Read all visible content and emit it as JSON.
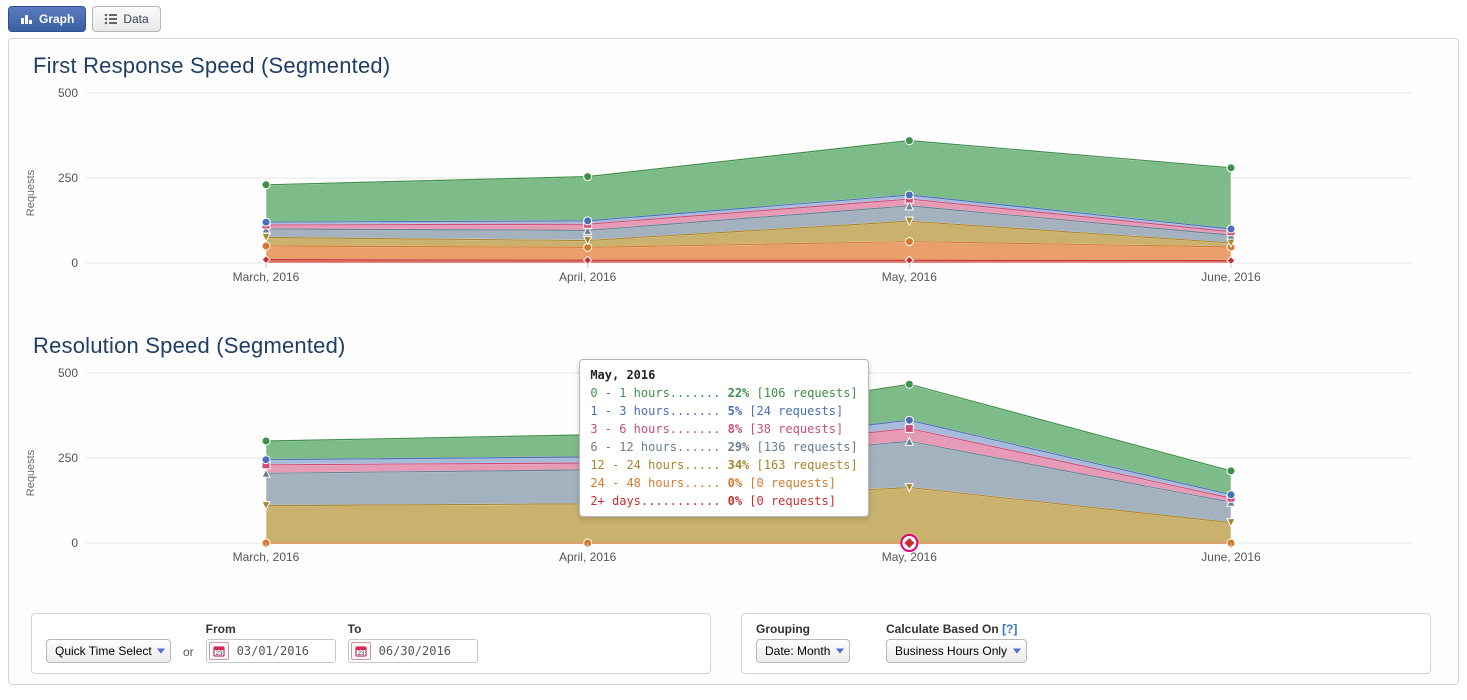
{
  "tabs": {
    "graph": "Graph",
    "data": "Data"
  },
  "charts": {
    "first_response": {
      "title": "First Response Speed (Segmented)",
      "ylabel": "Requests"
    },
    "resolution": {
      "title": "Resolution Speed (Segmented)",
      "ylabel": "Requests"
    }
  },
  "tooltip": {
    "title": "May, 2016",
    "rows": [
      {
        "label": "0 - 1 hours.......",
        "pct": "22%",
        "detail": "[106 requests]",
        "color": "#3f8f4a"
      },
      {
        "label": "1 - 3 hours.......",
        "pct": "5%",
        "detail": "[24 requests]",
        "color": "#4a6fb5"
      },
      {
        "label": "3 - 6 hours.......",
        "pct": "8%",
        "detail": "[38 requests]",
        "color": "#c94f7a"
      },
      {
        "label": "6 - 12 hours......",
        "pct": "29%",
        "detail": "[136 requests]",
        "color": "#6b7d92"
      },
      {
        "label": "12 - 24 hours.....",
        "pct": "34%",
        "detail": "[163 requests]",
        "color": "#a8862e"
      },
      {
        "label": "24 - 48 hours.....",
        "pct": "0%",
        "detail": "[0 requests]",
        "color": "#d47a2e"
      },
      {
        "label": "2+ days...........",
        "pct": "0%",
        "detail": "[0 requests]",
        "color": "#c73030"
      }
    ]
  },
  "controls": {
    "quick_time_label": "Quick Time Select",
    "or": "or",
    "from_label": "From",
    "to_label": "To",
    "from_value": "03/01/2016",
    "to_value": "06/30/2016",
    "grouping_label": "Grouping",
    "grouping_value": "Date: Month",
    "calc_label": "Calculate Based On",
    "calc_help": "[?]",
    "calc_value": "Business Hours Only"
  },
  "chart_data": [
    {
      "id": "first_response",
      "type": "area",
      "title": "First Response Speed (Segmented)",
      "xlabel": "",
      "ylabel": "Requests",
      "ylim": [
        0,
        500
      ],
      "yticks": [
        0,
        250,
        500
      ],
      "categories": [
        "March, 2016",
        "April, 2016",
        "May, 2016",
        "June, 2016"
      ],
      "series": [
        {
          "name": "2+ days",
          "color": "#c73030",
          "fill": "#d95b4a",
          "values": [
            10,
            8,
            8,
            7
          ]
        },
        {
          "name": "24 - 48 hours",
          "color": "#d47a2e",
          "fill": "#e6955a",
          "values": [
            40,
            38,
            55,
            40
          ]
        },
        {
          "name": "12 - 24 hours",
          "color": "#a8862e",
          "fill": "#c4a85e",
          "values": [
            25,
            20,
            60,
            12
          ]
        },
        {
          "name": "6 - 12 hours",
          "color": "#6b7d92",
          "fill": "#9aa8b8",
          "values": [
            25,
            30,
            45,
            23
          ]
        },
        {
          "name": "3 - 6 hours",
          "color": "#c94f7a",
          "fill": "#e38fae",
          "values": [
            12,
            18,
            20,
            10
          ]
        },
        {
          "name": "1 - 3 hours",
          "color": "#4a6fb5",
          "fill": "#9eb3d6",
          "values": [
            8,
            10,
            12,
            8
          ]
        },
        {
          "name": "0 - 1 hours",
          "color": "#3f8f4a",
          "fill": "#6fb47b",
          "values": [
            110,
            130,
            160,
            180
          ]
        }
      ]
    },
    {
      "id": "resolution",
      "type": "area",
      "title": "Resolution Speed (Segmented)",
      "xlabel": "",
      "ylabel": "Requests",
      "ylim": [
        0,
        500
      ],
      "yticks": [
        0,
        250,
        500
      ],
      "categories": [
        "March, 2016",
        "April, 2016",
        "May, 2016",
        "June, 2016"
      ],
      "series": [
        {
          "name": "2+ days",
          "color": "#c73030",
          "fill": "#d95b4a",
          "values": [
            0,
            0,
            0,
            0
          ]
        },
        {
          "name": "24 - 48 hours",
          "color": "#d47a2e",
          "fill": "#e6955a",
          "values": [
            0,
            0,
            0,
            0
          ]
        },
        {
          "name": "12 - 24 hours",
          "color": "#a8862e",
          "fill": "#c4a85e",
          "values": [
            110,
            115,
            163,
            60
          ]
        },
        {
          "name": "6 - 12 hours",
          "color": "#6b7d92",
          "fill": "#9aa8b8",
          "values": [
            95,
            100,
            136,
            60
          ]
        },
        {
          "name": "3 - 6 hours",
          "color": "#c94f7a",
          "fill": "#e38fae",
          "values": [
            25,
            20,
            38,
            12
          ]
        },
        {
          "name": "1 - 3 hours",
          "color": "#4a6fb5",
          "fill": "#9eb3d6",
          "values": [
            15,
            18,
            24,
            10
          ]
        },
        {
          "name": "0 - 1 hours",
          "color": "#3f8f4a",
          "fill": "#6fb47b",
          "values": [
            55,
            65,
            106,
            70
          ]
        }
      ],
      "tooltip_at": 2
    }
  ]
}
